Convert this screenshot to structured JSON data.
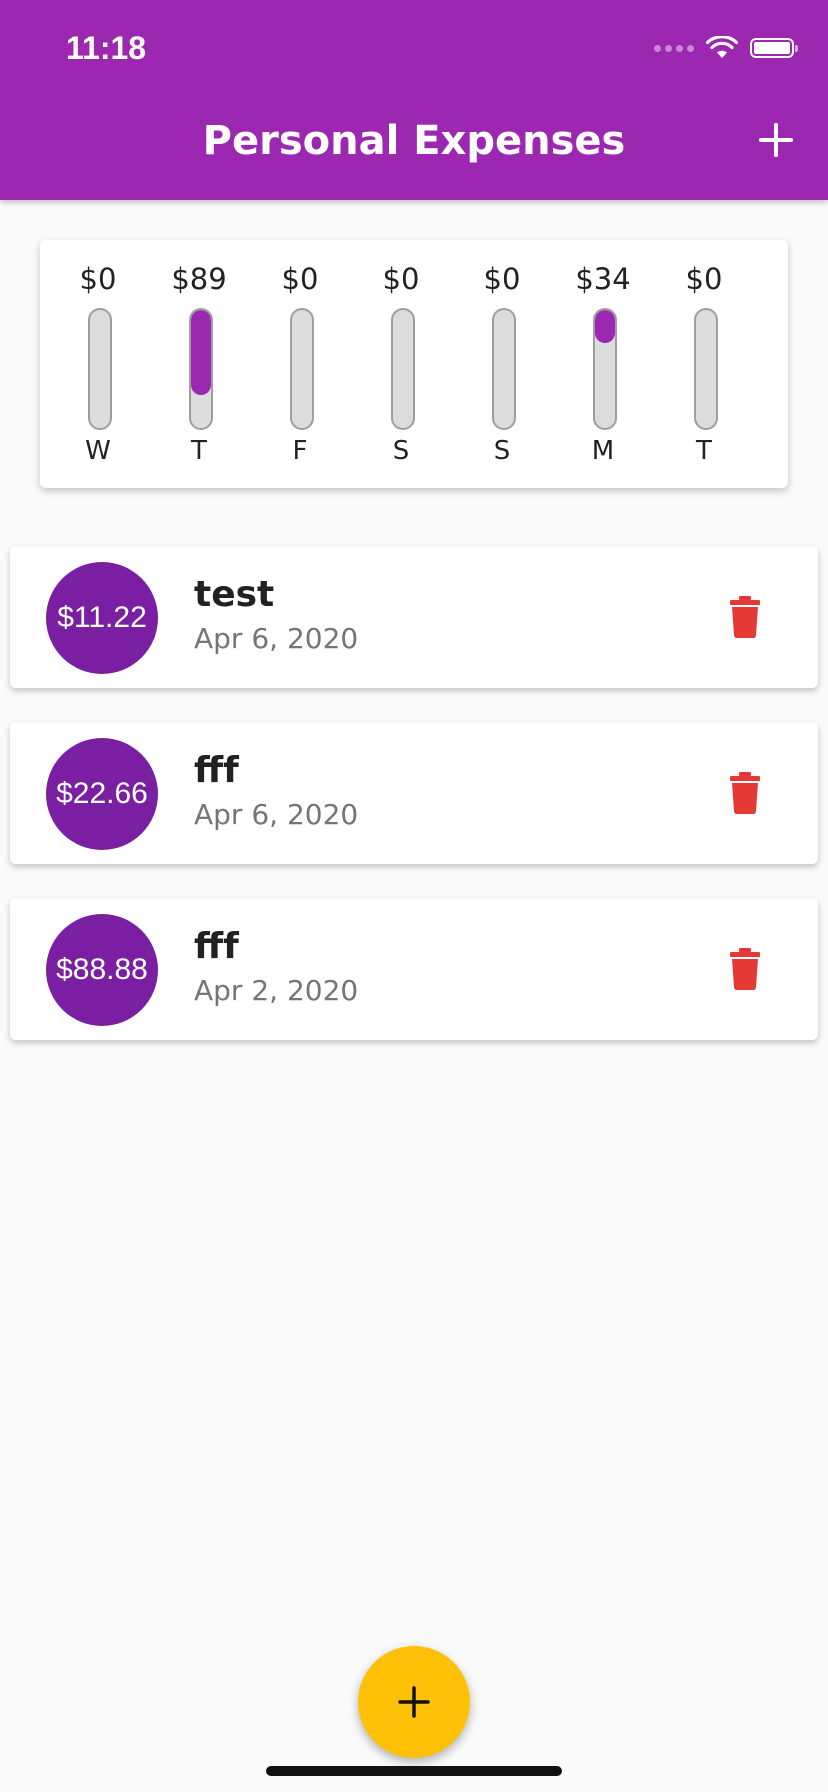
{
  "status_bar": {
    "time": "11:18"
  },
  "appbar": {
    "title": "Personal Expenses",
    "add_icon": "plus-icon"
  },
  "colors": {
    "primary": "#9c27b0",
    "avatar": "#7b1fa2",
    "accent": "#ffc107",
    "delete": "#e53935"
  },
  "chart": {
    "bars": [
      {
        "day": "W",
        "amount": "$0",
        "fraction": 0
      },
      {
        "day": "T",
        "amount": "$89",
        "fraction": 0.72
      },
      {
        "day": "F",
        "amount": "$0",
        "fraction": 0
      },
      {
        "day": "S",
        "amount": "$0",
        "fraction": 0
      },
      {
        "day": "S",
        "amount": "$0",
        "fraction": 0
      },
      {
        "day": "M",
        "amount": "$34",
        "fraction": 0.28
      },
      {
        "day": "T",
        "amount": "$0",
        "fraction": 0
      }
    ]
  },
  "transactions": [
    {
      "amount": "$11.22",
      "title": "test",
      "date": "Apr 6, 2020",
      "icon": "trash-icon"
    },
    {
      "amount": "$22.66",
      "title": "fff",
      "date": "Apr 6, 2020",
      "icon": "trash-icon"
    },
    {
      "amount": "$88.88",
      "title": "fff",
      "date": "Apr 2, 2020",
      "icon": "trash-icon"
    }
  ],
  "fab": {
    "icon": "plus-icon"
  }
}
